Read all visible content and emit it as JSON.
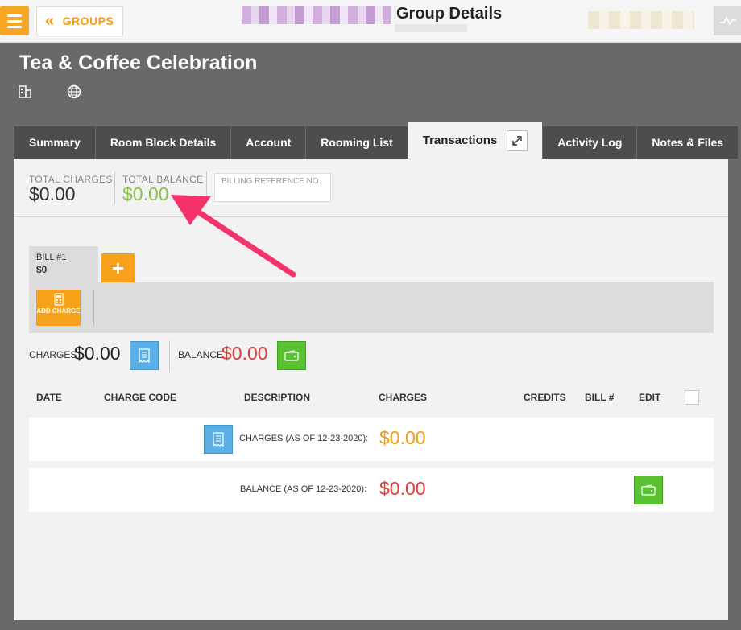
{
  "topbar": {
    "groups_label": "GROUPS",
    "title": "Group Details"
  },
  "group": {
    "name": "Tea & Coffee Celebration"
  },
  "tabs": [
    {
      "label": "Summary"
    },
    {
      "label": "Room Block Details"
    },
    {
      "label": "Account"
    },
    {
      "label": "Rooming List"
    },
    {
      "label": "Transactions"
    },
    {
      "label": "Activity Log"
    },
    {
      "label": "Notes & Files"
    }
  ],
  "summary": {
    "total_charges_label": "TOTAL CHARGES",
    "total_charges_value": "$0.00",
    "total_balance_label": "TOTAL BALANCE",
    "total_balance_value": "$0.00",
    "billing_ref_label": "BILLING REFERENCE NO."
  },
  "bill": {
    "tab_label": "BILL #1",
    "tab_amount": "$0",
    "add_label": "+",
    "add_charge_label": "ADD CHARGE",
    "charges_label": "CHARGES",
    "charges_value": "$0.00",
    "balance_label": "BALANCE",
    "balance_value": "$0.00"
  },
  "table": {
    "headers": [
      "DATE",
      "CHARGE CODE",
      "DESCRIPTION",
      "CHARGES",
      "CREDITS",
      "BILL #",
      "EDIT"
    ],
    "rows": [
      {
        "label": "CHARGES (AS OF 12-23-2020):",
        "amount": "$0.00"
      },
      {
        "label": "BALANCE (AS OF 12-23-2020):",
        "amount": "$0.00"
      }
    ]
  },
  "colors": {
    "accent_orange": "#f7a11a",
    "balance_green": "#8bc34a",
    "negative_red": "#e53935",
    "charges_orange": "#f39c12",
    "annotation_pink": "#f5336b"
  }
}
